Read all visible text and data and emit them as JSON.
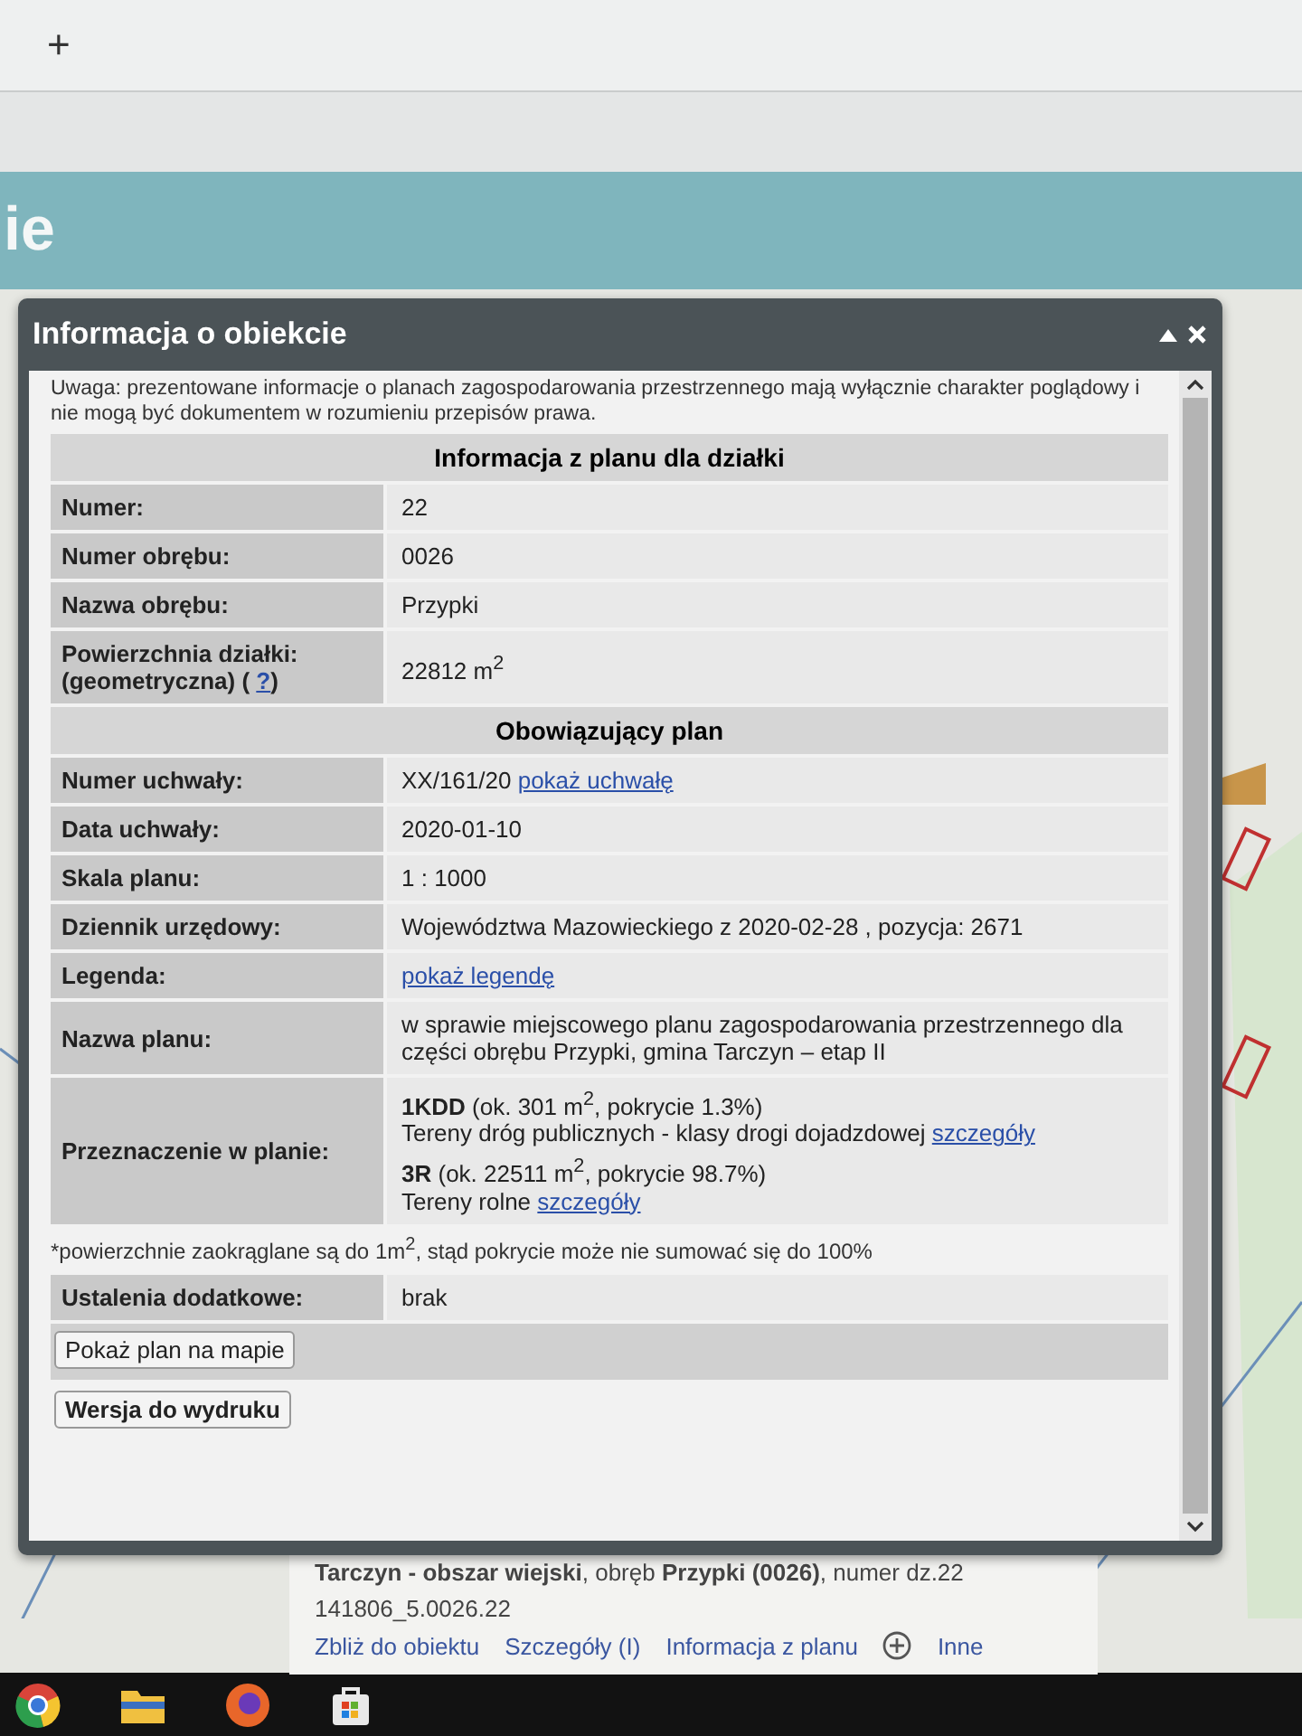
{
  "browser": {
    "new_tab": "+"
  },
  "site_header": {
    "title_fragment": "ie"
  },
  "dialog": {
    "title": "Informacja o obiekcie",
    "notice": "Uwaga: prezentowane informacje o planach zagospodarowania przestrzennego mają wyłącznie charakter poglądowy i nie mogą być dokumentem w rozumieniu przepisów prawa.",
    "items": [
      {
        "kind": "heading",
        "text": "Informacja z planu dla działki"
      },
      {
        "kind": "row",
        "label": [
          {
            "kind": "text",
            "text": "Numer:"
          }
        ],
        "value": [
          {
            "kind": "text",
            "text": "22"
          }
        ]
      },
      {
        "kind": "row",
        "label": [
          {
            "kind": "text",
            "text": "Numer obrębu:"
          }
        ],
        "value": [
          {
            "kind": "text",
            "text": "0026"
          }
        ]
      },
      {
        "kind": "row",
        "label": [
          {
            "kind": "text",
            "text": "Nazwa obrębu:"
          }
        ],
        "value": [
          {
            "kind": "text",
            "text": "Przypki"
          }
        ]
      },
      {
        "kind": "row",
        "label": [
          {
            "kind": "text",
            "text": "Powierzchnia działki: (geometryczna) ("
          },
          {
            "kind": "link",
            "text": "?"
          },
          {
            "kind": "text",
            "text": ")"
          }
        ],
        "value": [
          {
            "kind": "text",
            "text": "22812 m$^{2}$"
          }
        ]
      },
      {
        "kind": "heading",
        "text": "Obowiązujący plan"
      },
      {
        "kind": "row",
        "label": [
          {
            "kind": "text",
            "text": "Numer uchwały:"
          }
        ],
        "value": [
          {
            "kind": "text",
            "text": "XX/161/20"
          },
          {
            "kind": "link",
            "text": "pokaż uchwałę"
          }
        ]
      },
      {
        "kind": "row",
        "label": [
          {
            "kind": "text",
            "text": "Data uchwały:"
          }
        ],
        "value": [
          {
            "kind": "text",
            "text": "2020-01-10"
          }
        ]
      },
      {
        "kind": "row",
        "label": [
          {
            "kind": "text",
            "text": "Skala planu:"
          }
        ],
        "value": [
          {
            "kind": "text",
            "text": "1 : 1000"
          }
        ]
      },
      {
        "kind": "row",
        "label": [
          {
            "kind": "text",
            "text": "Dziennik urzędowy:"
          }
        ],
        "value": [
          {
            "kind": "text",
            "text": "Województwa Mazowieckiego z 2020-02-28 , pozycja: 2671"
          }
        ]
      },
      {
        "kind": "row",
        "label": [
          {
            "kind": "text",
            "text": "Legenda:"
          }
        ],
        "value": [
          {
            "kind": "link",
            "text": "pokaż legendę"
          }
        ]
      },
      {
        "kind": "row",
        "label": [
          {
            "kind": "text",
            "text": "Nazwa planu:"
          }
        ],
        "value": [
          {
            "kind": "text",
            "text": "w sprawie miejscowego planu zagospodarowania przestrzennego dla części obrębu Przypki, gmina Tarczyn – etap II"
          }
        ]
      },
      {
        "kind": "zoning",
        "label": "Przeznaczenie w planie:",
        "entries": [
          {
            "code": "1KDD",
            "area": "(ok. 301 m$^{2}$, pokrycie 1.3%)",
            "description": "Tereny dróg publicznych - klasy drogi dojadzdowej",
            "link": "szczegóły"
          },
          {
            "code": "3R",
            "area": "(ok. 22511 m$^{2}$, pokrycie 98.7%)",
            "description": "Tereny rolne",
            "link": "szczegóły"
          }
        ]
      },
      {
        "kind": "note",
        "text": "*powierzchnie zaokrąglane są do 1m$^{2}$, stąd pokrycie może nie sumować się do 100%"
      },
      {
        "kind": "row",
        "label": [
          {
            "kind": "text",
            "text": "Ustalenia dodatkowe:"
          }
        ],
        "value": [
          {
            "kind": "text",
            "text": "brak"
          }
        ]
      },
      {
        "kind": "button",
        "text": "Pokaż plan na mapie",
        "bold": false
      },
      {
        "kind": "button",
        "text": "Wersja do wydruku",
        "bold": true
      }
    ]
  },
  "map_popup": {
    "heading": "**Tarczyn - obszar wiejski**, obręb **Przypki (0026)**, numer dz.22",
    "identifier": "141806_5.0026.22",
    "links": [
      "Zbliż do obiektu",
      "Szczegóły (I)",
      "Informacja z planu"
    ],
    "more": "Inne"
  }
}
